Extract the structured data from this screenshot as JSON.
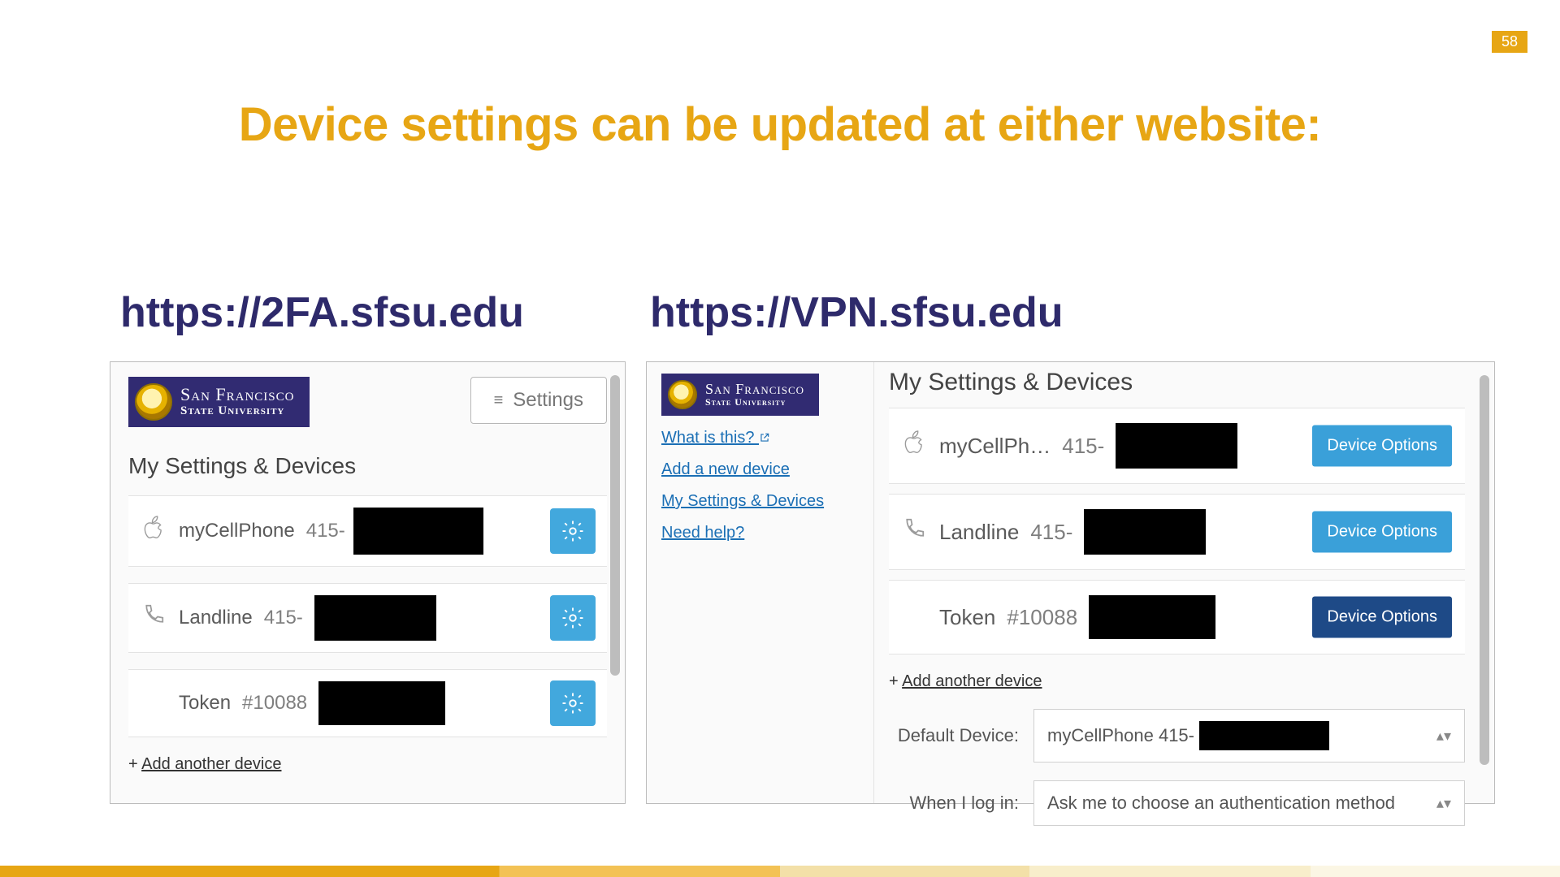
{
  "slide": {
    "number": "58",
    "title": "Device settings can be updated at either website:"
  },
  "urls": {
    "left": "https://2FA.sfsu.edu",
    "right": "https://VPN.sfsu.edu"
  },
  "brand": {
    "line1": "San Francisco",
    "line2": "State University"
  },
  "left_panel": {
    "settings_button": "Settings",
    "heading": "My Settings & Devices",
    "devices": [
      {
        "icon": "apple",
        "name": "myCellPhone",
        "number_prefix": "415-"
      },
      {
        "icon": "phone",
        "name": "Landline",
        "number_prefix": "415-"
      },
      {
        "icon": "",
        "name": "Token",
        "number_prefix": "#10088"
      }
    ],
    "add_another": "Add another device"
  },
  "right_panel": {
    "sidebar_links": {
      "what_is_this": "What is this?",
      "add_new_device": "Add a new device",
      "my_settings": "My Settings & Devices",
      "need_help": "Need help?"
    },
    "heading": "My Settings & Devices",
    "device_options_label": "Device Options",
    "devices": [
      {
        "icon": "apple",
        "name": "myCellPh…",
        "number_prefix": "415-"
      },
      {
        "icon": "phone",
        "name": "Landline",
        "number_prefix": "415-"
      },
      {
        "icon": "",
        "name": "Token",
        "number_prefix": "#10088"
      }
    ],
    "add_another": "Add another device",
    "default_device_label": "Default Device:",
    "default_device_value": "myCellPhone 415-",
    "when_login_label": "When I log in:",
    "when_login_value": "Ask me to choose an authentication method"
  }
}
